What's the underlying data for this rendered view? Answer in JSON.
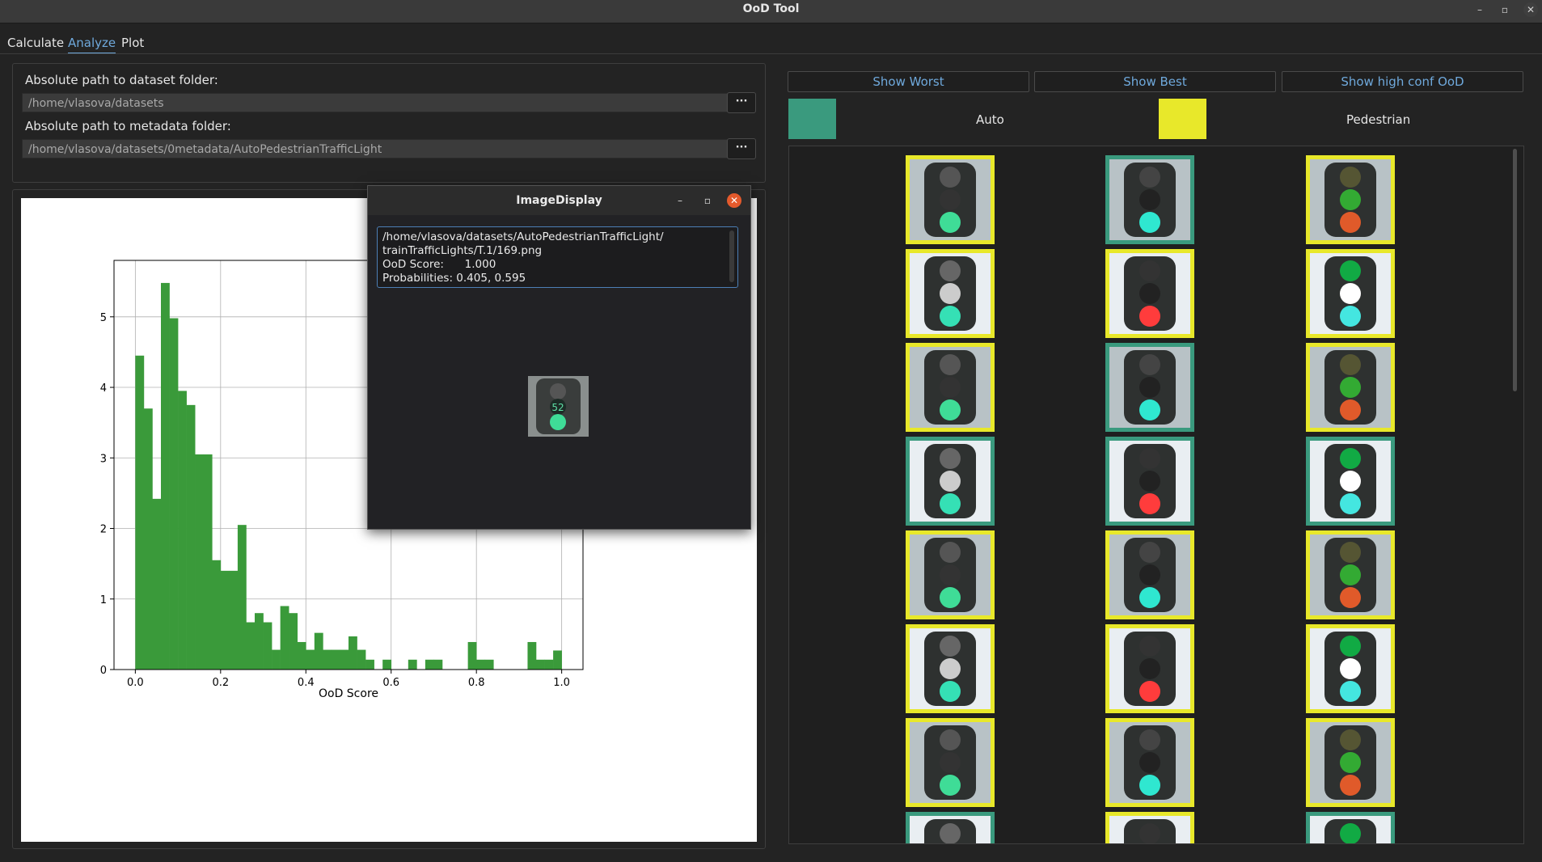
{
  "window": {
    "title": "OoD Tool",
    "controls": [
      "minimize",
      "maximize",
      "close"
    ]
  },
  "tabs": [
    {
      "label": "Calculate",
      "active": false
    },
    {
      "label": "Analyze",
      "active": true
    },
    {
      "label": "Plot",
      "active": false
    }
  ],
  "paths": {
    "dataset_label": "Absolute path to dataset folder:",
    "dataset_value": "/home/vlasova/datasets",
    "metadata_label": "Absolute path to metadata folder:",
    "metadata_value": "/home/vlasova/datasets/0metadata/AutoPedestrianTrafficLight",
    "browse_label": "···"
  },
  "buttons": {
    "show_worst": "Show Worst",
    "show_best": "Show Best",
    "show_high_conf": "Show high conf OoD"
  },
  "legend": [
    {
      "label": "Auto",
      "color": "#3a9a7e"
    },
    {
      "label": "Pedestrian",
      "color": "#e8e82a"
    }
  ],
  "thumbnails": [
    [
      "Pedestrian",
      "Auto",
      "Pedestrian"
    ],
    [
      "Pedestrian",
      "Pedestrian",
      "Pedestrian"
    ],
    [
      "Pedestrian",
      "Auto",
      "Pedestrian"
    ],
    [
      "Auto",
      "Auto",
      "Auto"
    ],
    [
      "Pedestrian",
      "Pedestrian",
      "Pedestrian"
    ],
    [
      "Pedestrian",
      "Pedestrian",
      "Pedestrian"
    ],
    [
      "Pedestrian",
      "Pedestrian",
      "Pedestrian"
    ],
    [
      "Auto",
      "Pedestrian",
      "Auto"
    ]
  ],
  "dialog": {
    "title": "ImageDisplay",
    "path_line1": "/home/vlasova/datasets/AutoPedestrianTrafficLight/",
    "path_line2": "trainTrafficLights/T.1/169.png",
    "score_line": "OoD Score:      1.000",
    "prob_line": "Probabilities: 0.405, 0.595"
  },
  "chart_data": {
    "type": "bar",
    "title": "",
    "xlabel": "OoD Score",
    "ylabel": "",
    "xlim": [
      -0.05,
      1.05
    ],
    "ylim": [
      0,
      5.8
    ],
    "xticks": [
      "0.0",
      "0.2",
      "0.4",
      "0.6",
      "0.8",
      "1.0"
    ],
    "yticks": [
      "0",
      "1",
      "2",
      "3",
      "4",
      "5"
    ],
    "grid": true,
    "bin_width": 0.02,
    "bin_starts": [
      0.0,
      0.02,
      0.04,
      0.06,
      0.08,
      0.1,
      0.12,
      0.14,
      0.16,
      0.18,
      0.2,
      0.22,
      0.24,
      0.26,
      0.28,
      0.3,
      0.32,
      0.34,
      0.36,
      0.38,
      0.4,
      0.42,
      0.44,
      0.46,
      0.48,
      0.5,
      0.52,
      0.54,
      0.56,
      0.58,
      0.6,
      0.62,
      0.64,
      0.66,
      0.68,
      0.7,
      0.72,
      0.74,
      0.76,
      0.78,
      0.8,
      0.82,
      0.84,
      0.86,
      0.88,
      0.9,
      0.92,
      0.94,
      0.96,
      0.98
    ],
    "values": [
      4.45,
      3.7,
      2.42,
      5.48,
      4.98,
      3.95,
      3.75,
      3.05,
      3.05,
      1.55,
      1.4,
      1.4,
      2.05,
      0.67,
      0.8,
      0.67,
      0.28,
      0.9,
      0.8,
      0.39,
      0.28,
      0.52,
      0.28,
      0.28,
      0.28,
      0.47,
      0.28,
      0.14,
      0.0,
      0.14,
      0.0,
      0.0,
      0.14,
      0.0,
      0.14,
      0.14,
      0.0,
      0.0,
      0.0,
      0.39,
      0.14,
      0.14,
      0.0,
      0.0,
      0.0,
      0.0,
      0.39,
      0.14,
      0.14,
      0.27
    ],
    "color": "#3a9a3a"
  }
}
